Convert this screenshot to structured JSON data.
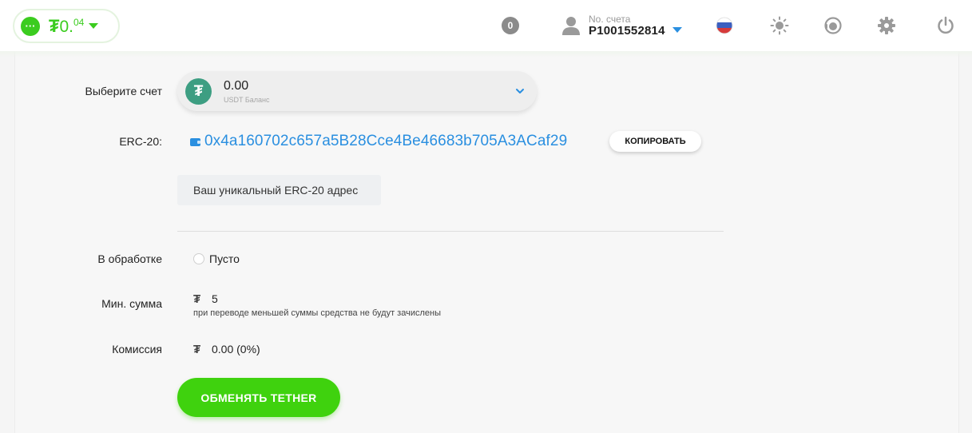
{
  "header": {
    "balance": {
      "menu_icon": "dots-icon",
      "currency_symbol": "₮",
      "amount_main": "0.",
      "amount_decimals": "04",
      "accent_color": "#3bcc1f"
    },
    "notifications_count": "0",
    "account": {
      "label": "No. счета",
      "number": "P1001552814"
    },
    "icons": [
      "flag-ru-icon",
      "sun-icon",
      "support-icon",
      "gear-icon",
      "power-icon"
    ]
  },
  "form": {
    "select_account": {
      "label": "Выберите счет",
      "amount": "0.00",
      "sub_label": "USDT Баланс",
      "logo_symbol": "₮"
    },
    "erc": {
      "label": "ERC-20:",
      "address": "0x4a160702c657a5B28Cce4Be46683b705A3ACaf29",
      "copy_label": "КОПИРОВАТЬ",
      "hint": "Ваш уникальный ERC-20 адрес",
      "link_color": "#2a8fe0"
    },
    "pending": {
      "label": "В обработке",
      "value": "Пусто"
    },
    "min_amount": {
      "label": "Мин. сумма",
      "symbol": "₮",
      "value": "5",
      "note": "при переводе меньшей суммы средства не будут зачислены"
    },
    "fee": {
      "label": "Комиссия",
      "symbol": "₮",
      "value": "0.00 (0%)"
    },
    "submit_label": "ОБМЕНЯТЬ TETHER",
    "submit_color": "#3fd20e"
  }
}
